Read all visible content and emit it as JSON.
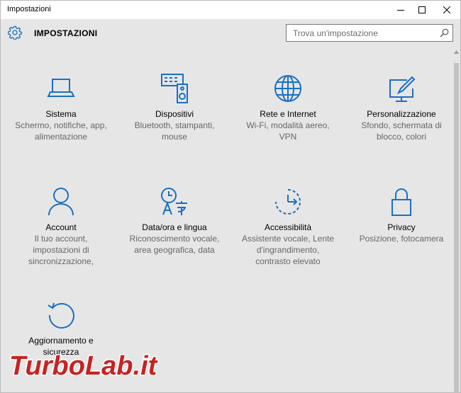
{
  "window": {
    "title": "Impostazioni"
  },
  "header": {
    "title": "IMPOSTAZIONI"
  },
  "search": {
    "placeholder": "Trova un'impostazione"
  },
  "tiles": [
    {
      "name": "Sistema",
      "desc": "Schermo, notifiche, app,\nalimentazione",
      "icon": "laptop-icon"
    },
    {
      "name": "Dispositivi",
      "desc": "Bluetooth, stampanti,\nmouse",
      "icon": "devices-icon"
    },
    {
      "name": "Rete e Internet",
      "desc": "Wi-Fi, modalità aereo,\nVPN",
      "icon": "globe-icon"
    },
    {
      "name": "Personalizzazione",
      "desc": "Sfondo, schermata di\nblocco, colori",
      "icon": "personalization-icon"
    },
    {
      "name": "Account",
      "desc": "Il tuo account,\nimpostazioni di\nsincronizzazione,",
      "icon": "person-icon"
    },
    {
      "name": "Data/ora e lingua",
      "desc": "Riconoscimento vocale,\narea geografica, data",
      "icon": "time-language-icon"
    },
    {
      "name": "Accessibilità",
      "desc": "Assistente vocale, Lente\nd'ingrandimento,\ncontrasto elevato",
      "icon": "ease-of-access-icon"
    },
    {
      "name": "Privacy",
      "desc": "Posizione, fotocamera",
      "icon": "lock-icon"
    },
    {
      "name": "Aggiornamento e\nsicurezza",
      "desc": "",
      "icon": "update-icon"
    }
  ],
  "watermark": {
    "text": "TurboLab.it"
  },
  "colors": {
    "accent": "#1a6fc4",
    "background": "#e6e6e6",
    "watermark": "#c72222"
  }
}
